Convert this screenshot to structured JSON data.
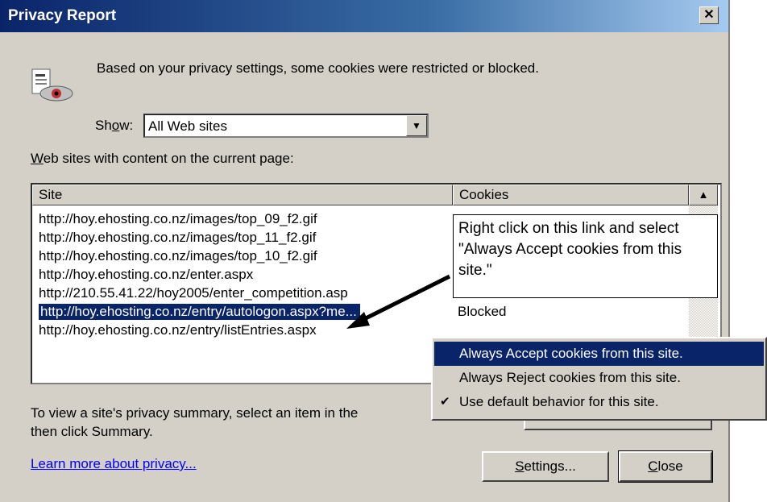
{
  "window": {
    "title": "Privacy Report",
    "close_glyph": "✕"
  },
  "info": {
    "icon": "privacy-eye-icon",
    "message": "Based on your privacy settings, some cookies were restricted or blocked."
  },
  "show": {
    "label_pre": "Sh",
    "label_ul": "o",
    "label_post": "w:",
    "selected": "All Web sites"
  },
  "sites_label": {
    "ul": "W",
    "rest": "eb sites with content on the current page:"
  },
  "table": {
    "columns": [
      "Site",
      "Cookies"
    ],
    "rows": [
      {
        "site": "http://hoy.ehosting.co.nz/images/top_09_f2.gif",
        "cookies": ""
      },
      {
        "site": "http://hoy.ehosting.co.nz/images/top_11_f2.gif",
        "cookies": ""
      },
      {
        "site": "http://hoy.ehosting.co.nz/images/top_10_f2.gif",
        "cookies": ""
      },
      {
        "site": "http://hoy.ehosting.co.nz/enter.aspx",
        "cookies": ""
      },
      {
        "site": "http://210.55.41.22/hoy2005/enter_competition.asp",
        "cookies": ""
      },
      {
        "site": "http://hoy.ehosting.co.nz/entry/autologon.aspx?me...",
        "cookies": "Blocked"
      },
      {
        "site": "http://hoy.ehosting.co.nz/entry/listEntries.aspx",
        "cookies": ""
      }
    ],
    "selected_row": 5
  },
  "callout": {
    "text": "Right click on this link and select \"Always Accept cookies from this site.\""
  },
  "context_menu": {
    "items": [
      {
        "label": "Always Accept cookies from this site.",
        "highlighted": true,
        "checked": false
      },
      {
        "label": "Always Reject cookies from this site.",
        "highlighted": false,
        "checked": false
      },
      {
        "label": "Use default behavior for this site.",
        "highlighted": false,
        "checked": true
      }
    ]
  },
  "summary_text": {
    "line1": "To view a site's privacy summary, select an item in the",
    "line2": "then click Summary."
  },
  "learn_more": "Learn more about privacy...",
  "buttons": {
    "settings": {
      "ul": "S",
      "rest": "ettings..."
    },
    "close": {
      "ul": "C",
      "rest": "lose"
    }
  }
}
